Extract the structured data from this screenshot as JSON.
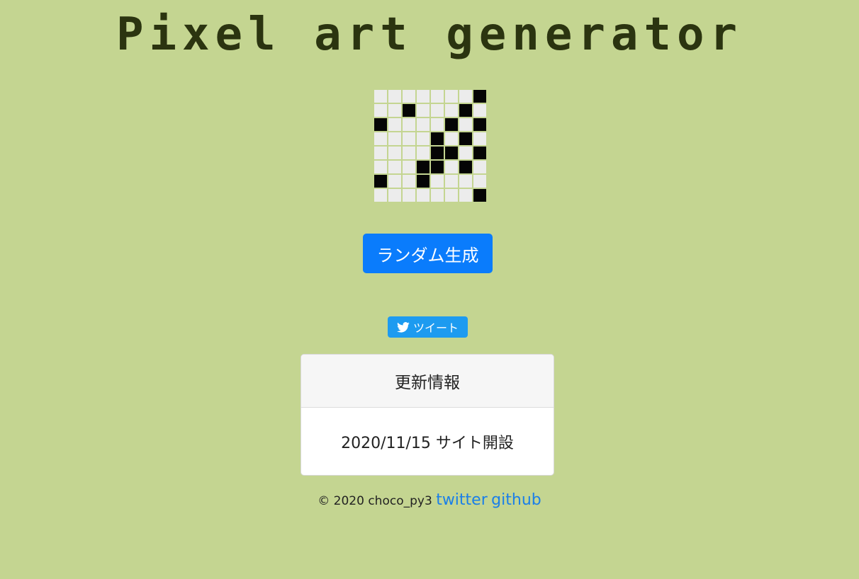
{
  "header": {
    "title": "Pixel art generator"
  },
  "pixel_grid": {
    "columns": 8,
    "rows": 8,
    "cells": [
      [
        0,
        0,
        0,
        0,
        0,
        0,
        0,
        1
      ],
      [
        0,
        0,
        1,
        0,
        0,
        0,
        1,
        0
      ],
      [
        1,
        0,
        0,
        0,
        0,
        1,
        0,
        1
      ],
      [
        0,
        0,
        0,
        0,
        1,
        0,
        1,
        0
      ],
      [
        0,
        0,
        0,
        0,
        1,
        1,
        0,
        1
      ],
      [
        0,
        0,
        0,
        1,
        1,
        0,
        1,
        0
      ],
      [
        1,
        0,
        0,
        1,
        0,
        0,
        0,
        0
      ],
      [
        0,
        0,
        0,
        0,
        0,
        0,
        0,
        1
      ]
    ],
    "on_color": "#050505",
    "off_color": "#ececec"
  },
  "actions": {
    "generate_label": "ランダム生成",
    "tweet_label": "ツイート"
  },
  "updates": {
    "header": "更新情報",
    "entry": "2020/11/15 サイト開設"
  },
  "footer": {
    "copyright": "© 2020 choco_py3",
    "twitter_label": "twitter",
    "github_label": "github"
  },
  "colors": {
    "background": "#c4d591",
    "title": "#2b3410",
    "primary_button": "#0a7cfc",
    "tweet_button": "#1d9bf0",
    "link": "#1a7fe8"
  }
}
